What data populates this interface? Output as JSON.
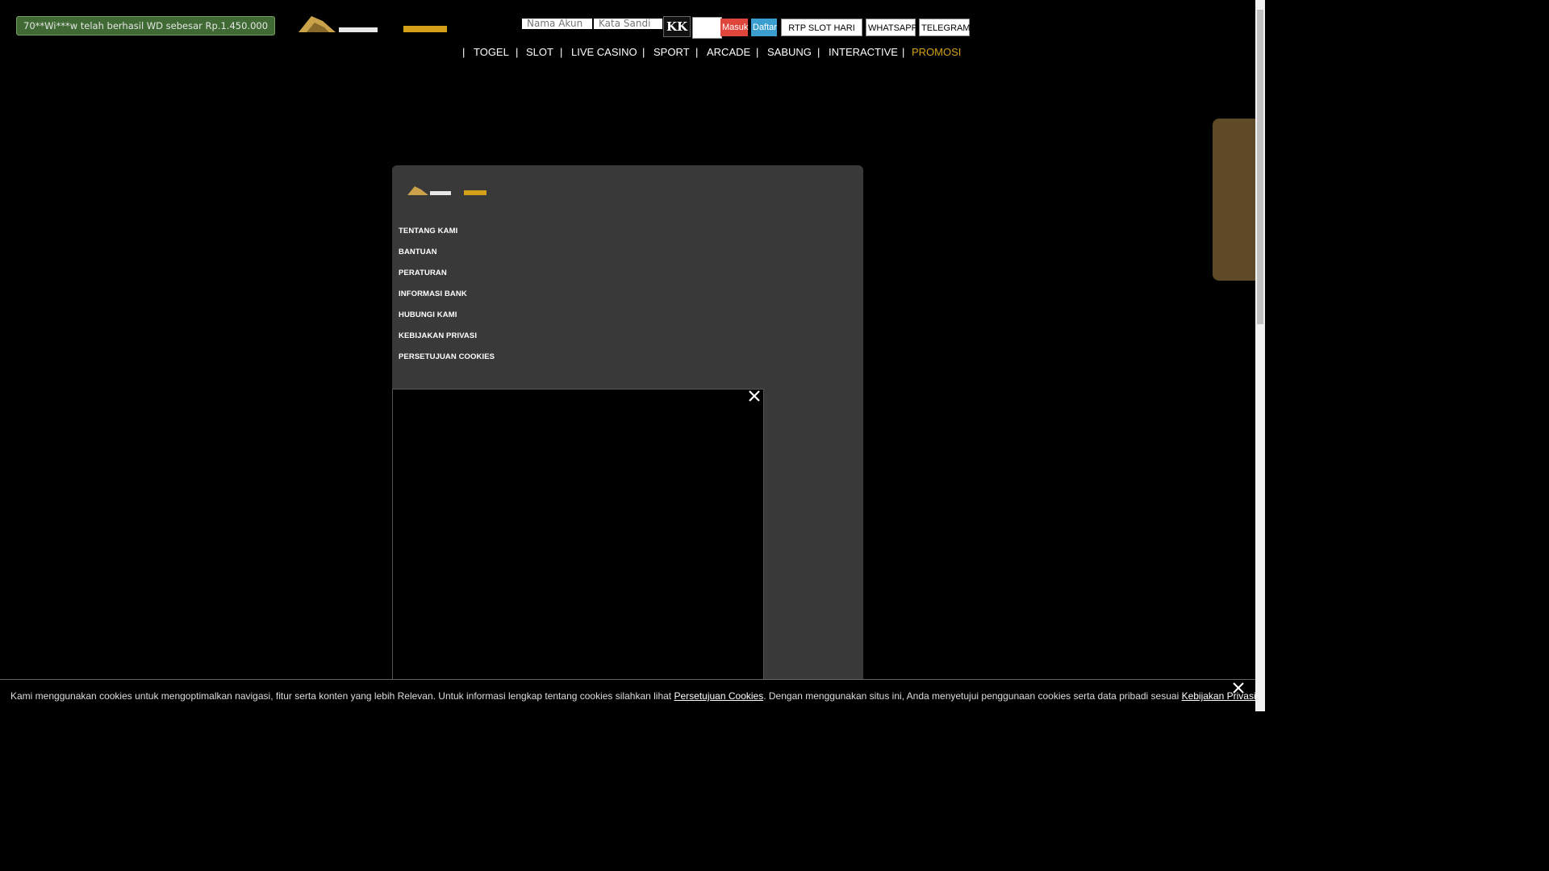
{
  "notification": {
    "text": "70**Wi***w telah berhasil WD sebesar Rp.1.450.000"
  },
  "login": {
    "username_placeholder": "Nama Akun",
    "password_placeholder": "Kata Sandi",
    "captcha_text": "KK",
    "login_label": "Masuk",
    "register_label": "Daftar"
  },
  "header_buttons": {
    "rtp": "RTP SLOT HARI INI",
    "whatsapp": "WHATSAPP",
    "telegram": "TELEGRAM"
  },
  "nav": {
    "separator": "|",
    "items": [
      "TOGEL",
      "SLOT",
      "LIVE CASINO",
      "SPORT",
      "ARCADE",
      "SABUNG",
      "INTERACTIVE",
      "PROMOSI"
    ]
  },
  "footer_links": [
    "TENTANG KAMI",
    "BANTUAN",
    "PERATURAN",
    "INFORMASI BANK",
    "HUBUNGI KAMI",
    "KEBIJAKAN PRIVASI",
    "PERSETUJUAN COOKIES"
  ],
  "video": {
    "close_icon": "close-icon"
  },
  "cookie": {
    "text_before": "Kami menggunakan cookies untuk mengoptimalkan navigasi, fitur serta konten yang lebih Relevan. Untuk informasi lengkap tentang cookies silahkan lihat ",
    "link1": "Persetujuan Cookies",
    "text_middle": ". Dengan menggunakan situs ini, Anda menyetujui penggunaan cookies serta data pribadi sesuai ",
    "link2": "Kebijakan Privasi",
    "text_after": "."
  },
  "colors": {
    "background": "#000000",
    "accent_gold": "#d4a017",
    "login_red": "#e0453b",
    "register_blue": "#3b9ed0",
    "notification_green": "#3f6a33",
    "panel": "#393939"
  }
}
